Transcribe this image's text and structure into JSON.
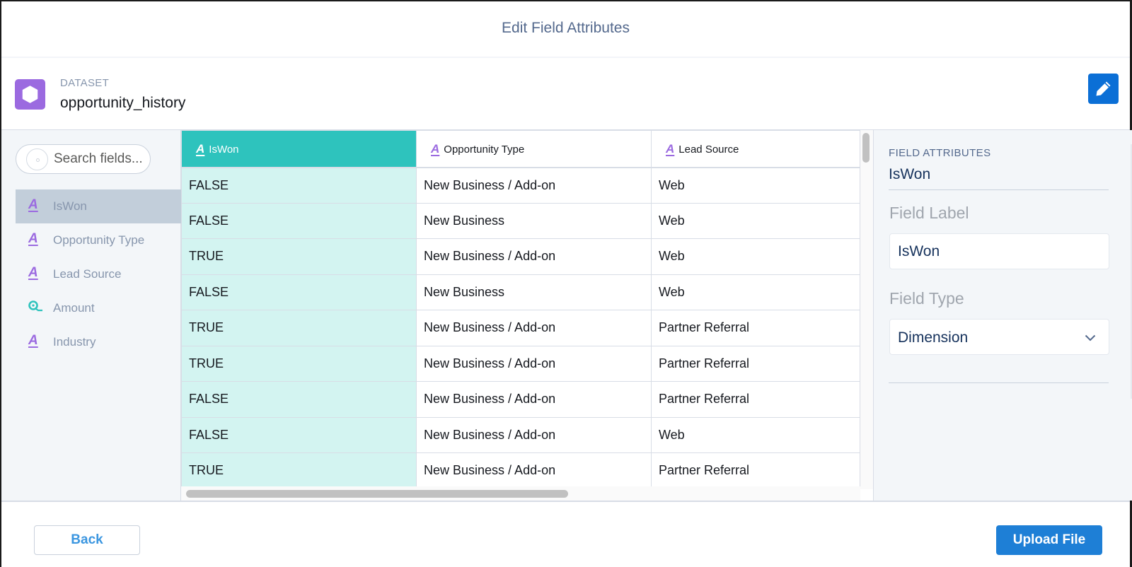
{
  "header": {
    "title": "Edit Field Attributes"
  },
  "dataset": {
    "label": "DATASET",
    "name": "opportunity_history",
    "icon": "dataset-hexagon-icon",
    "edit_icon": "pencil-icon"
  },
  "sidebar": {
    "search_placeholder": "Search fields...",
    "fields": [
      {
        "label": "IsWon",
        "type": "dimension",
        "icon": "text-A-icon",
        "selected": true
      },
      {
        "label": "Opportunity Type",
        "type": "dimension",
        "icon": "text-A-icon",
        "selected": false
      },
      {
        "label": "Lead Source",
        "type": "dimension",
        "icon": "text-A-icon",
        "selected": false
      },
      {
        "label": "Amount",
        "type": "measure",
        "icon": "measure-icon",
        "selected": false
      },
      {
        "label": "Industry",
        "type": "dimension",
        "icon": "text-A-icon",
        "selected": false
      }
    ]
  },
  "grid": {
    "columns": [
      {
        "label": "IsWon",
        "icon": "text-A-icon",
        "selected": true
      },
      {
        "label": "Opportunity Type",
        "icon": "text-A-icon",
        "selected": false
      },
      {
        "label": "Lead Source",
        "icon": "text-A-icon",
        "selected": false
      }
    ],
    "rows": [
      [
        "FALSE",
        "New Business / Add-on",
        "Web"
      ],
      [
        "FALSE",
        "New Business",
        "Web"
      ],
      [
        "TRUE",
        "New Business / Add-on",
        "Web"
      ],
      [
        "FALSE",
        "New Business",
        "Web"
      ],
      [
        "TRUE",
        "New Business / Add-on",
        "Partner Referral"
      ],
      [
        "TRUE",
        "New Business / Add-on",
        "Partner Referral"
      ],
      [
        "FALSE",
        "New Business / Add-on",
        "Partner Referral"
      ],
      [
        "FALSE",
        "New Business / Add-on",
        "Web"
      ],
      [
        "TRUE",
        "New Business / Add-on",
        "Partner Referral"
      ]
    ]
  },
  "attributes": {
    "section_title": "FIELD ATTRIBUTES",
    "field_name": "IsWon",
    "field_label_title": "Field Label",
    "field_label_value": "IsWon",
    "field_type_title": "Field Type",
    "field_type_value": "Dimension"
  },
  "footer": {
    "back_label": "Back",
    "upload_label": "Upload File"
  },
  "colors": {
    "accent_teal": "#2ec3bd",
    "selected_column_bg": "#d3f4f1",
    "dimension_icon": "#9b6ae0",
    "measure_icon": "#2ec3bd",
    "primary_button": "#1e7fd6"
  }
}
